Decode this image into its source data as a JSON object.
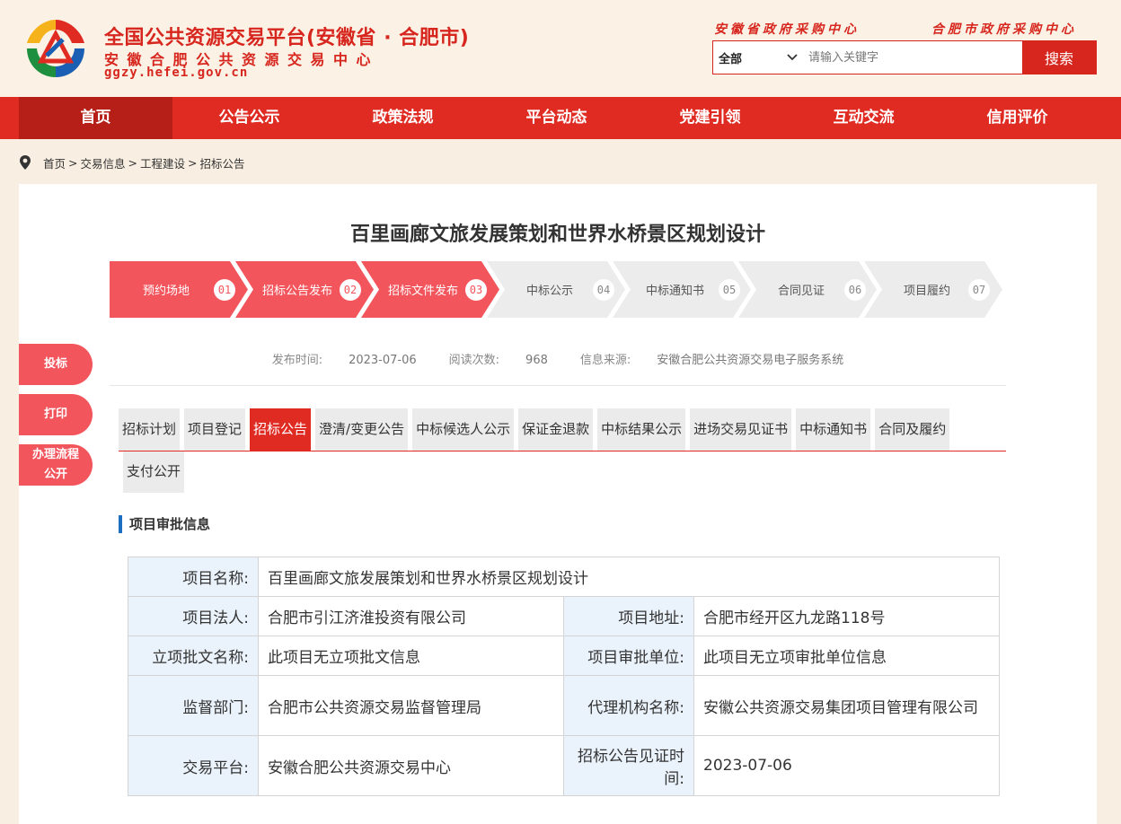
{
  "header": {
    "site_title": "全国公共资源交易平台(安徽省 · 合肥市)",
    "site_subtitle": "安徽合肥公共资源交易中心",
    "site_domain": "ggzy.hefei.gov.cn",
    "links": [
      "安徽省政府采购中心",
      "合肥市政府采购中心"
    ],
    "search": {
      "scope": "全部",
      "placeholder": "请输入关键字",
      "button": "搜索"
    }
  },
  "nav": {
    "items": [
      "首页",
      "公告公示",
      "政策法规",
      "平台动态",
      "党建引领",
      "互动交流",
      "信用评价"
    ],
    "active": 0
  },
  "breadcrumb": {
    "items": [
      "首页",
      "交易信息",
      "工程建设",
      "招标公告"
    ]
  },
  "page": {
    "title": "百里画廊文旅发展策划和世界水桥景区规划设计",
    "steps": [
      {
        "label": "预约场地",
        "num": "01",
        "done": true
      },
      {
        "label": "招标公告发布",
        "num": "02",
        "done": true
      },
      {
        "label": "招标文件发布",
        "num": "03",
        "done": true
      },
      {
        "label": "中标公示",
        "num": "04",
        "done": false
      },
      {
        "label": "中标通知书",
        "num": "05",
        "done": false
      },
      {
        "label": "合同见证",
        "num": "06",
        "done": false
      },
      {
        "label": "项目履约",
        "num": "07",
        "done": false
      }
    ],
    "meta": {
      "publish_label": "发布时间:",
      "publish_value": "2023-07-06",
      "reads_label": "阅读次数:",
      "reads_value": "968",
      "source_label": "信息来源:",
      "source_value": "安徽合肥公共资源交易电子服务系统"
    },
    "side_buttons": [
      "投标",
      "打印",
      "办理流程公开"
    ],
    "tabs": [
      "招标计划",
      "项目登记",
      "招标公告",
      "澄清/变更公告",
      "中标候选人公示",
      "保证金退款",
      "中标结果公示",
      "进场交易见证书",
      "中标通知书",
      "合同及履约",
      "支付公开"
    ],
    "active_tab": 2,
    "section_title": "项目审批信息",
    "info": {
      "project_name_label": "项目名称:",
      "project_name": "百里画廊文旅发展策划和世界水桥景区规划设计",
      "legal_person_label": "项目法人:",
      "legal_person": "合肥市引江济淮投资有限公司",
      "address_label": "项目地址:",
      "address": "合肥市经开区九龙路118号",
      "approval_doc_label": "立项批文名称:",
      "approval_doc": "此项目无立项批文信息",
      "approval_unit_label": "项目审批单位:",
      "approval_unit": "此项目无立项审批单位信息",
      "supervisor_label": "监督部门:",
      "supervisor": "合肥市公共资源交易监督管理局",
      "agency_label": "代理机构名称:",
      "agency": "安徽公共资源交易集团项目管理有限公司",
      "platform_label": "交易平台:",
      "platform": "安徽合肥公共资源交易中心",
      "witness_time_label": "招标公告见证时间:",
      "witness_time": "2023-07-06"
    }
  },
  "colors": {
    "brand_red": "#e02b23",
    "step_done": "#f3555d",
    "step_todo": "#ececec",
    "label_bg": "#eaf2fb",
    "accent_blue": "#1c6fc1"
  }
}
